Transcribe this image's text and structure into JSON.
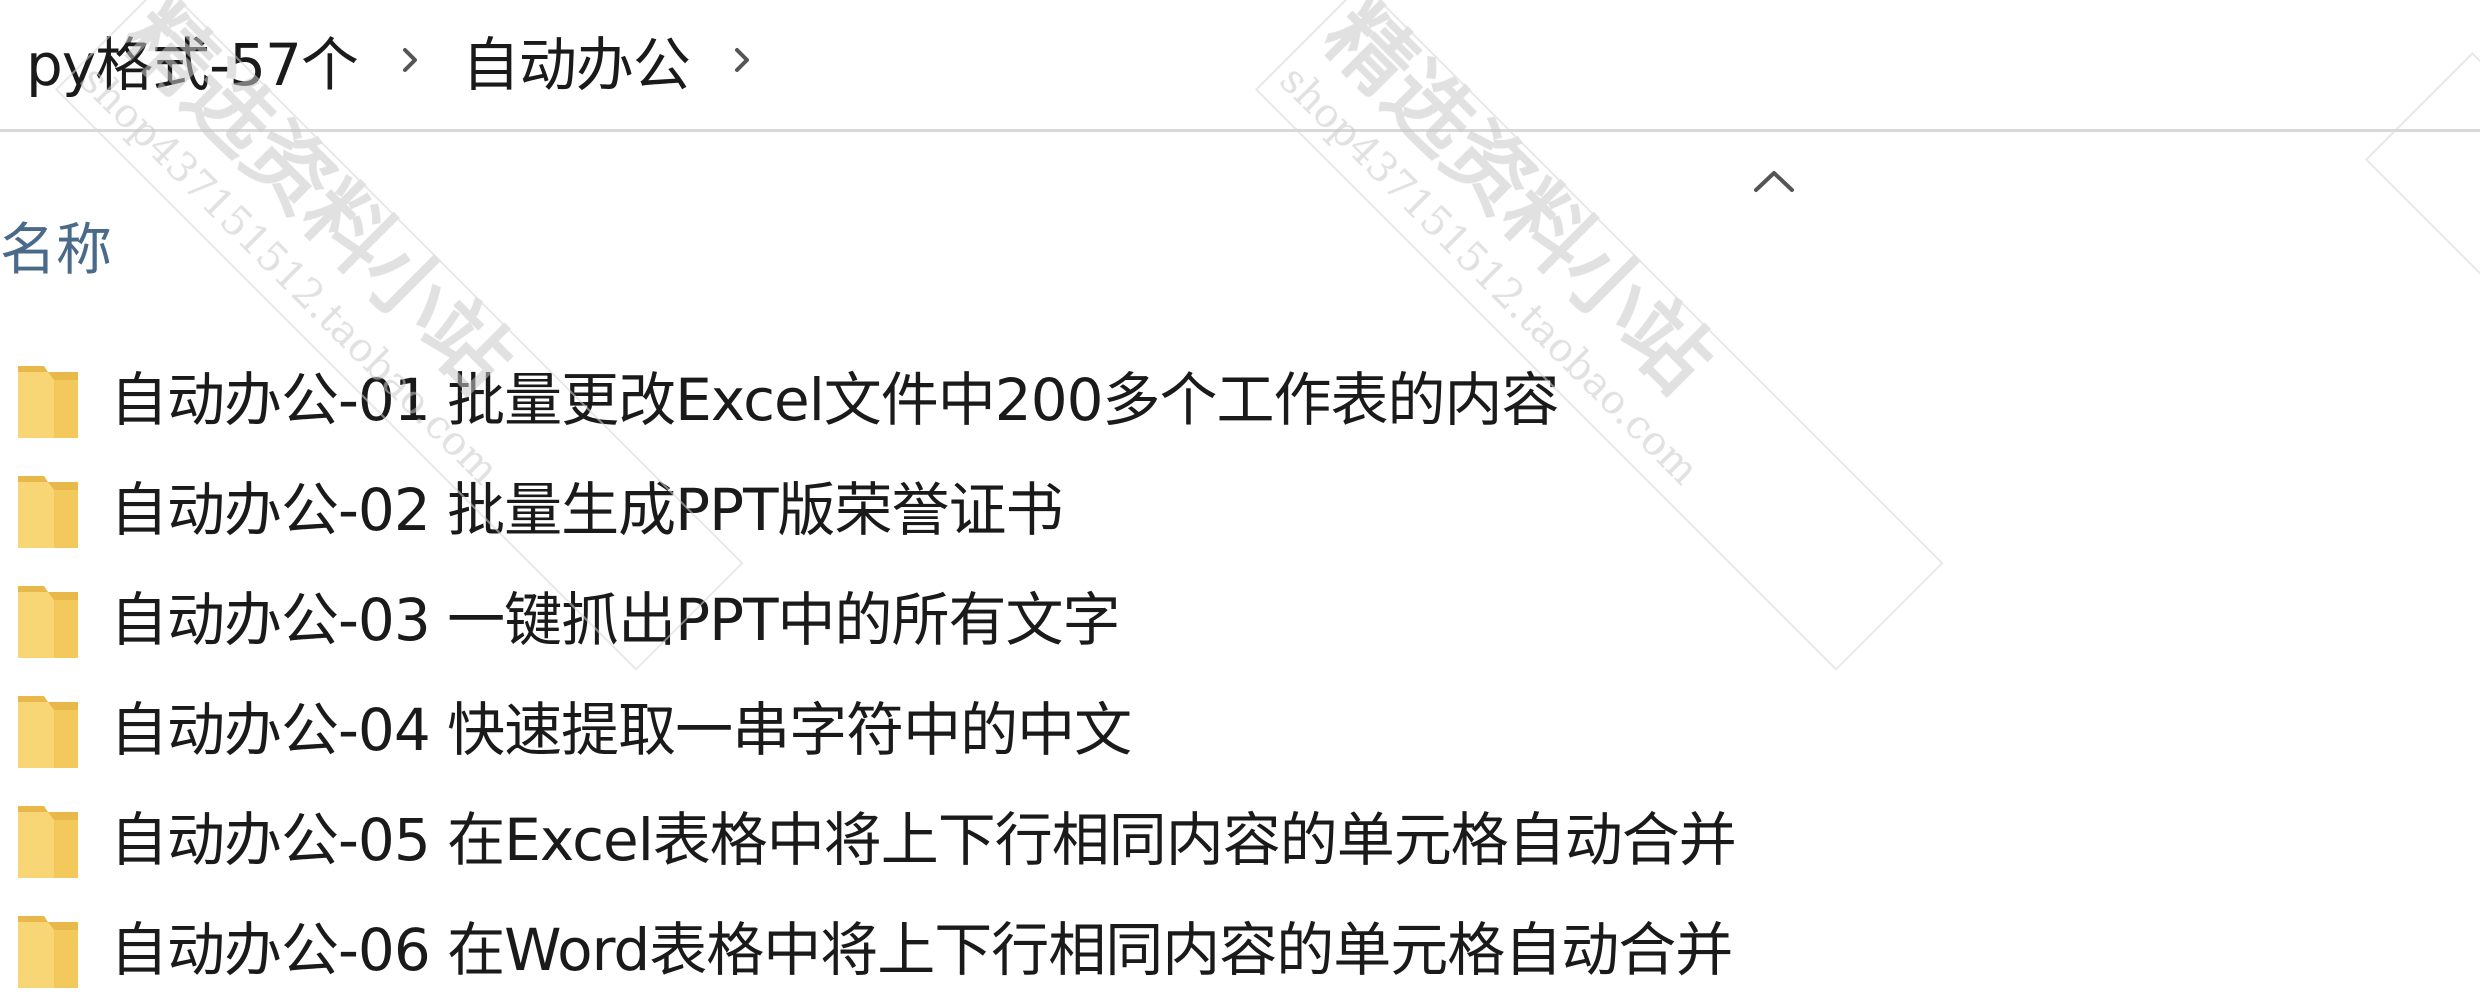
{
  "breadcrumb": {
    "items": [
      {
        "label": "py格式-57个"
      },
      {
        "label": "自动办公"
      }
    ]
  },
  "list": {
    "column_header": "名称",
    "sort_direction": "ascending",
    "items": [
      {
        "name": "自动办公-01 批量更改Excel文件中200多个工作表的内容",
        "icon": "folder-icon"
      },
      {
        "name": "自动办公-02 批量生成PPT版荣誉证书",
        "icon": "folder-icon"
      },
      {
        "name": "自动办公-03 一键抓出PPT中的所有文字",
        "icon": "folder-icon"
      },
      {
        "name": "自动办公-04 快速提取一串字符中的中文",
        "icon": "folder-icon"
      },
      {
        "name": "自动办公-05 在Excel表格中将上下行相同内容的单元格自动合并",
        "icon": "folder-icon"
      },
      {
        "name": "自动办公-06 在Word表格中将上下行相同内容的单元格自动合并",
        "icon": "folder-icon"
      }
    ]
  },
  "watermark": {
    "text_cn": "精选资料小站",
    "text_url": "shop437151512.taobao.com"
  },
  "colors": {
    "folder_fill": "#f8d675",
    "folder_tab": "#e8b84a",
    "header_text": "#4a6a8a",
    "divider": "#d9d9d9",
    "watermark": "#d0d0d0"
  }
}
